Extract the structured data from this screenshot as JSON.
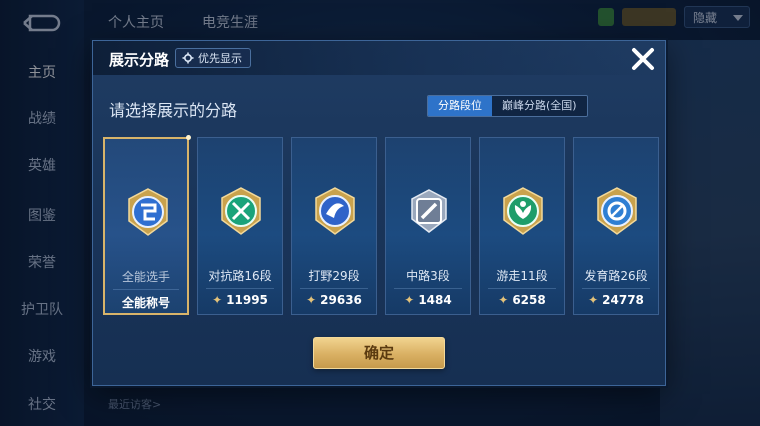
{
  "background": {
    "sidebar": [
      {
        "label": "主页",
        "active": true
      },
      {
        "label": "战绩",
        "active": false
      },
      {
        "label": "英雄",
        "active": false
      },
      {
        "label": "图鉴",
        "active": false
      },
      {
        "label": "荣誉",
        "active": false
      },
      {
        "label": "护卫队",
        "active": false
      },
      {
        "label": "游戏",
        "active": false
      },
      {
        "label": "社交",
        "active": false
      }
    ],
    "top_tabs": [
      "个人主页",
      "电竞生涯"
    ],
    "dropdown_value": "隐藏",
    "recent_visitors_label": "最近访客>"
  },
  "modal": {
    "title": "展示分路",
    "priority_label": "优先显示",
    "subtitle": "请选择展示的分路",
    "segments": [
      {
        "label": "分路段位",
        "active": true
      },
      {
        "label": "巅峰分路(全国)",
        "active": false
      }
    ],
    "cards": [
      {
        "name": "全能选手",
        "foot": "全能称号",
        "score": null,
        "selected": true,
        "badge": "all-rounder-icon",
        "color": "#2f6fd1"
      },
      {
        "name": "对抗路16段",
        "foot": null,
        "score": "11995",
        "selected": false,
        "badge": "clash-lane-icon",
        "color": "#1aa37a"
      },
      {
        "name": "打野29段",
        "foot": null,
        "score": "29636",
        "selected": false,
        "badge": "jungle-icon",
        "color": "#2f63c9"
      },
      {
        "name": "中路3段",
        "foot": null,
        "score": "1484",
        "selected": false,
        "badge": "mid-lane-icon",
        "color": "#6f7e96"
      },
      {
        "name": "游走11段",
        "foot": null,
        "score": "6258",
        "selected": false,
        "badge": "roam-icon",
        "color": "#1e9d6a"
      },
      {
        "name": "发育路26段",
        "foot": null,
        "score": "24778",
        "selected": false,
        "badge": "farm-lane-icon",
        "color": "#2f7fd3"
      }
    ],
    "confirm_label": "确定"
  },
  "colors": {
    "accent_blue": "#2e73c9",
    "gold": "#d8b46a",
    "panel": "#1a355a"
  }
}
